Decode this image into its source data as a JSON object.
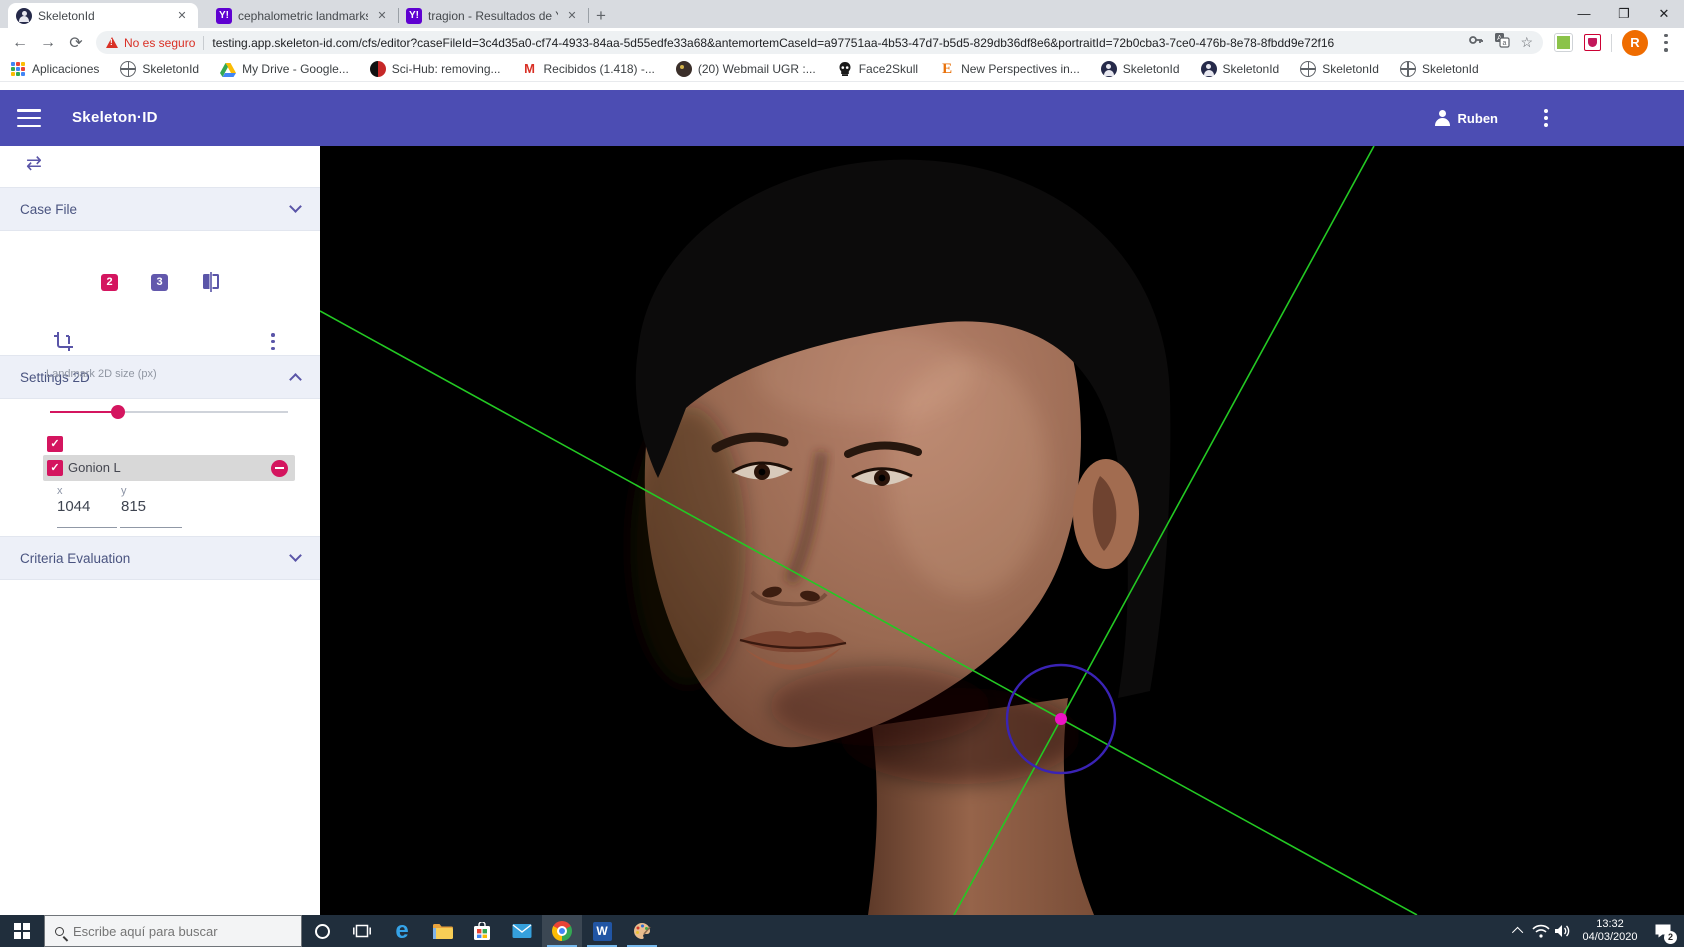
{
  "browser": {
    "tabs": [
      {
        "label": "SkeletonId"
      },
      {
        "label": "cephalometric landmarks in obli"
      },
      {
        "label": "tragion - Resultados de Yahoo Es"
      }
    ],
    "window_controls": {
      "minimize": "—",
      "restore": "❐",
      "close": "✕"
    },
    "nav": {
      "back": "←",
      "forward": "→",
      "reload": "⟳"
    },
    "security_label": "No es seguro",
    "url": "testing.app.skeleton-id.com/cfs/editor?caseFileId=3c4d35a0-cf74-4933-84aa-5d55edfe33a68&antemortemCaseId=a97751aa-4b53-47d7-b5d5-829db36df8e6&portraitId=72b0cba3-7ce0-476b-8e78-8fbdd9e72f16",
    "profile_initial": "R",
    "bookmarks": [
      {
        "label": "Aplicaciones",
        "icon": "google-apps-grid"
      },
      {
        "label": "SkeletonId",
        "icon": "globe"
      },
      {
        "label": "My Drive - Google...",
        "icon": "google-drive"
      },
      {
        "label": "Sci-Hub: removing...",
        "icon": "sci-hub-raven"
      },
      {
        "label": "Recibidos (1.418) -...",
        "icon": "gmail-m"
      },
      {
        "label": "(20) Webmail UGR :...",
        "icon": "webmail"
      },
      {
        "label": "Face2Skull",
        "icon": "skull"
      },
      {
        "label": "New Perspectives in...",
        "icon": "orange-e"
      },
      {
        "label": "SkeletonId",
        "icon": "person-circle"
      },
      {
        "label": "SkeletonId",
        "icon": "person-circle"
      },
      {
        "label": "SkeletonId",
        "icon": "globe"
      },
      {
        "label": "SkeletonId",
        "icon": "globe"
      }
    ]
  },
  "app": {
    "title": "Skeleton·ID",
    "user_name": "Ruben",
    "sidebar": {
      "case_file_label": "Case File",
      "view_2d_badge": "2",
      "view_3d_badge": "3",
      "settings_2d_label": "Settings 2D",
      "landmark_size_label": "Landmark 2D size (px)",
      "checkbox_glyph": "✓",
      "landmark_row": {
        "name": "Gonion L"
      },
      "coords": {
        "x_label": "x",
        "x_value": "1044",
        "y_label": "y",
        "y_value": "815"
      },
      "criteria_label": "Criteria Evaluation"
    }
  },
  "viewport": {
    "landmark": {
      "name": "Gonion L",
      "image_x": "1044",
      "image_y": "815"
    }
  },
  "taskbar": {
    "search_placeholder": "Escribe aquí para buscar",
    "clock_time": "13:32",
    "clock_date": "04/03/2020",
    "notification_badge": "2"
  },
  "colors": {
    "header_purple": "#4c4db3",
    "accent_pink": "#d4155f",
    "accent_purple": "#5a55a8",
    "section_bg": "#edf0f8",
    "line_green": "#23c923",
    "landmark_circle_purple": "#3a23b5",
    "landmark_dot_magenta": "#ec13c4",
    "warning_red": "#d93025",
    "taskbar_dark": "#202e3c"
  }
}
